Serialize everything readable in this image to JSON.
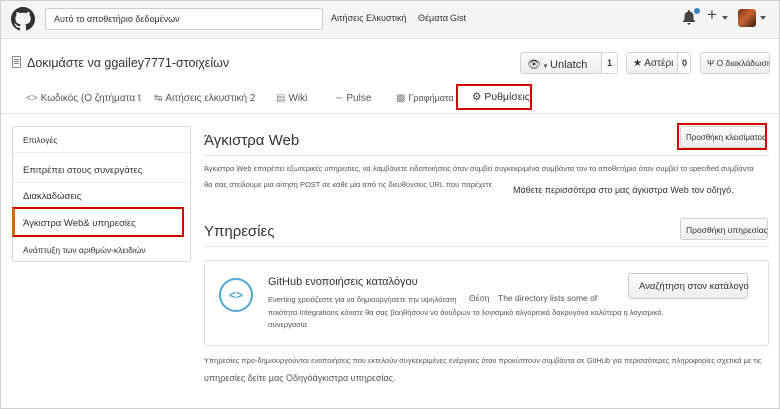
{
  "header": {
    "search_value": "Αυτό το αποθετήριο δεδομένων",
    "nav": [
      "Αιτήσεις Ελκυστική",
      "Θέματα",
      "Gist"
    ],
    "plus_label": "+",
    "icons": [
      "github-logo-icon",
      "bell-icon",
      "plus-icon",
      "avatar"
    ]
  },
  "repo": {
    "title": "Δοκιμάστε να ggailey7771-στοιχείων",
    "unwatch_label": "Unlatch",
    "unwatch_count": "1",
    "star_label": "Αστέρι",
    "star_count": "0",
    "fork_label": "Ο διακλάδωση"
  },
  "tabs": {
    "code": "Κωδικός (Ο ζητήματα t",
    "pulls": "Αιτήσεις ελκυστική 2",
    "wiki": "Wiki",
    "pulse": "Pulse",
    "graphs": "Γραφήματα",
    "settings": "Ρυθμίσεις"
  },
  "sidebar": {
    "items": [
      "Επιλογές",
      "Επιτρέπει στους συνεργάτες",
      "Διακλαδώσεις",
      "Άγκιστρα Web& υπηρεσίες",
      "Ανάπτυξη των αριθμών-κλειδιών"
    ]
  },
  "webhooks": {
    "title": "Άγκιστρα Web",
    "add_button": "Προσθήκη κλεισίματος web",
    "desc_line1": "Άγκιστρα Web επιτρέπει εξωτερικές υπηρεσίες, να λαμβάνετε ειδοποιήσεις όταν συμβεί συγκεκριμένα συμβάντα τον το αποθετήριο όταν συμβεί το specified συμβάντα",
    "desc_line2": "θα σας στείλουμε μια αίτηση POST σε κάθε μία από τις διευθύνσεις URL που παρέχετε",
    "learn_more": "Μάθετε περισσότερα στο μας άγκιστρα Web τον οδηγό."
  },
  "services": {
    "title": "Υπηρεσίες",
    "add_button": "Προσθήκη υπηρεσίας",
    "catalog_title": "GitHub ενοποιήσεις καταλόγου",
    "catalog_line1a": "Everting χρειάζεστε για να δημιουργήσετε την υψηλότατη",
    "catalog_line1b": "Θέση",
    "catalog_line1c": "The directory lists some of",
    "catalog_line2": "ποιότητα Integrations κάνατε θα σας βοηθήσουν να άνυδρων το λογισμικό αλγοριτικά δακρυγόνα καλύτερα η λογισμικό.",
    "catalog_line3": "συνεργασία",
    "browse_button": "Αναζήτηση στον κατάλογο",
    "footer_line1": "Υπηρεσίες προ-δημιουργούνται ενοποιήσεις που εκτελούν συγκεκριμένες ενέργειες όταν προκύπτουν συμβάντα σε GitHub για περισσότερες πληροφορίες σχετικά με τις",
    "footer_line2": "υπηρεσίες δείτε μας Οδηγόάγκιστρα υπηρεσίας."
  }
}
